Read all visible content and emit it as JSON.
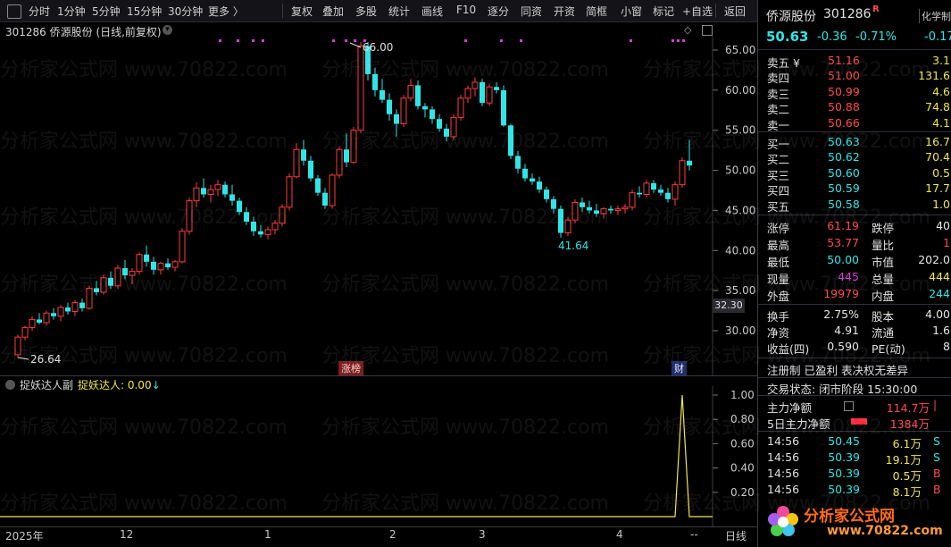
{
  "toolbar": {
    "items": [
      "分时",
      "1分钟",
      "5分钟",
      "15分钟",
      "30分钟",
      "更多 〉",
      "复权",
      "叠加",
      "多股",
      "统计",
      "画线",
      "F10",
      "逐分",
      "同资",
      "开资",
      "简框",
      "小窗",
      "标记",
      "+自选",
      "返回"
    ]
  },
  "chart_header": {
    "title": "301286  侨源股份 (日线,前复权)"
  },
  "main_chart": {
    "y_ticks": [
      "65.00",
      "60.00",
      "55.00",
      "50.00",
      "45.00",
      "40.00",
      "35.00",
      "30.00"
    ],
    "price_tag": "32.30",
    "high_label": "66.00",
    "low_label": "41.64",
    "start_label": "26.64",
    "event_tags": [
      "涨榜",
      "财"
    ]
  },
  "indicator": {
    "name": "捉妖达人副",
    "value_label": "捉妖达人: 0.00",
    "arrow": "↓",
    "y_ticks": [
      "1.00",
      "0.80",
      "0.60",
      "0.40",
      "0.20"
    ]
  },
  "x_axis": {
    "labels": [
      "2025年",
      "12",
      "1",
      "2",
      "3",
      "4",
      "--"
    ],
    "period": "日线"
  },
  "chart_data": {
    "type": "candlestick",
    "ylim": [
      27,
      67
    ],
    "candles": [
      [
        27.0,
        29.5,
        26.6,
        29.2
      ],
      [
        29.2,
        30.6,
        28.8,
        30.4
      ],
      [
        30.4,
        31.8,
        30.0,
        31.4
      ],
      [
        31.4,
        32.2,
        30.8,
        31.0
      ],
      [
        31.0,
        32.5,
        30.6,
        32.2
      ],
      [
        32.2,
        32.8,
        31.4,
        31.8
      ],
      [
        31.8,
        33.2,
        31.2,
        32.9
      ],
      [
        32.9,
        33.5,
        32.0,
        32.4
      ],
      [
        32.4,
        33.8,
        31.8,
        33.5
      ],
      [
        33.5,
        34.0,
        32.4,
        32.8
      ],
      [
        32.8,
        35.6,
        32.6,
        35.3
      ],
      [
        35.3,
        36.2,
        34.4,
        34.8
      ],
      [
        34.8,
        37.0,
        34.5,
        36.6
      ],
      [
        36.6,
        37.4,
        35.2,
        35.6
      ],
      [
        35.6,
        38.2,
        35.2,
        37.8
      ],
      [
        37.8,
        38.8,
        36.4,
        36.9
      ],
      [
        36.9,
        37.8,
        35.8,
        37.4
      ],
      [
        37.4,
        39.8,
        37.0,
        39.5
      ],
      [
        39.5,
        40.6,
        38.0,
        38.6
      ],
      [
        38.6,
        39.2,
        37.0,
        37.6
      ],
      [
        37.6,
        38.6,
        37.0,
        38.4
      ],
      [
        38.4,
        39.0,
        37.6,
        37.9
      ],
      [
        37.9,
        38.8,
        37.4,
        38.6
      ],
      [
        38.6,
        42.8,
        38.4,
        42.4
      ],
      [
        42.4,
        46.6,
        42.0,
        46.2
      ],
      [
        46.2,
        48.5,
        45.4,
        47.8
      ],
      [
        47.8,
        49.0,
        46.6,
        47.0
      ],
      [
        47.0,
        48.2,
        46.0,
        47.6
      ],
      [
        47.6,
        48.8,
        46.8,
        48.2
      ],
      [
        48.2,
        48.6,
        46.6,
        47.0
      ],
      [
        47.0,
        48.2,
        45.6,
        46.2
      ],
      [
        46.2,
        46.6,
        44.4,
        44.8
      ],
      [
        44.8,
        45.4,
        43.2,
        43.6
      ],
      [
        43.6,
        44.2,
        41.8,
        42.4
      ],
      [
        42.4,
        43.2,
        41.6,
        42.0
      ],
      [
        42.0,
        43.0,
        41.4,
        42.6
      ],
      [
        42.6,
        43.8,
        42.0,
        43.4
      ],
      [
        43.4,
        45.8,
        43.0,
        45.4
      ],
      [
        45.4,
        49.6,
        45.0,
        49.2
      ],
      [
        49.2,
        53.4,
        49.0,
        52.6
      ],
      [
        52.6,
        53.8,
        50.6,
        51.2
      ],
      [
        51.2,
        51.8,
        48.6,
        49.0
      ],
      [
        49.0,
        49.4,
        46.8,
        47.2
      ],
      [
        47.2,
        47.8,
        45.2,
        45.6
      ],
      [
        45.6,
        49.6,
        45.2,
        49.4
      ],
      [
        49.4,
        53.0,
        49.0,
        52.6
      ],
      [
        52.6,
        54.6,
        50.4,
        51.0
      ],
      [
        51.0,
        55.4,
        50.8,
        55.0
      ],
      [
        55.0,
        66.0,
        54.6,
        65.5
      ],
      [
        65.5,
        66.0,
        61.2,
        62.0
      ],
      [
        62.0,
        62.8,
        59.2,
        60.0
      ],
      [
        60.0,
        61.4,
        58.4,
        58.8
      ],
      [
        58.8,
        59.6,
        56.2,
        57.0
      ],
      [
        57.0,
        57.6,
        54.2,
        55.8
      ],
      [
        55.8,
        59.4,
        55.4,
        59.0
      ],
      [
        59.0,
        61.4,
        58.6,
        60.6
      ],
      [
        60.6,
        61.2,
        57.6,
        58.0
      ],
      [
        58.0,
        58.4,
        56.6,
        57.6
      ],
      [
        57.6,
        58.0,
        55.8,
        56.4
      ],
      [
        56.4,
        57.0,
        54.8,
        55.2
      ],
      [
        55.2,
        55.8,
        53.6,
        54.2
      ],
      [
        54.2,
        57.0,
        53.8,
        56.6
      ],
      [
        56.6,
        59.4,
        56.2,
        59.0
      ],
      [
        59.0,
        60.6,
        58.4,
        60.2
      ],
      [
        60.2,
        61.6,
        59.2,
        61.0
      ],
      [
        61.0,
        61.4,
        58.0,
        58.4
      ],
      [
        58.4,
        60.8,
        58.0,
        60.4
      ],
      [
        60.4,
        61.0,
        59.6,
        60.0
      ],
      [
        60.0,
        60.6,
        55.4,
        55.6
      ],
      [
        55.6,
        55.8,
        51.4,
        51.8
      ],
      [
        51.8,
        52.4,
        49.6,
        50.2
      ],
      [
        50.2,
        50.8,
        48.6,
        49.0
      ],
      [
        49.0,
        49.6,
        48.2,
        48.6
      ],
      [
        48.6,
        49.2,
        47.2,
        47.6
      ],
      [
        47.6,
        48.0,
        46.0,
        46.4
      ],
      [
        46.4,
        46.8,
        44.6,
        45.2
      ],
      [
        45.2,
        45.6,
        41.6,
        42.2
      ],
      [
        42.2,
        44.2,
        41.8,
        43.8
      ],
      [
        43.8,
        46.4,
        43.4,
        46.0
      ],
      [
        46.0,
        46.6,
        44.8,
        45.4
      ],
      [
        45.4,
        46.2,
        44.6,
        45.0
      ],
      [
        45.0,
        45.8,
        44.2,
        44.6
      ],
      [
        44.6,
        45.4,
        44.0,
        45.2
      ],
      [
        45.2,
        45.6,
        44.6,
        45.0
      ],
      [
        45.0,
        45.6,
        44.4,
        45.2
      ],
      [
        45.2,
        45.8,
        44.6,
        45.4
      ],
      [
        45.4,
        47.6,
        45.0,
        47.2
      ],
      [
        47.2,
        48.0,
        46.6,
        47.0
      ],
      [
        47.0,
        48.8,
        46.6,
        48.4
      ],
      [
        48.4,
        48.8,
        47.2,
        47.6
      ],
      [
        47.6,
        48.2,
        46.8,
        47.2
      ],
      [
        47.2,
        47.8,
        46.0,
        46.4
      ],
      [
        46.4,
        48.6,
        45.6,
        48.2
      ],
      [
        48.2,
        51.6,
        47.8,
        51.2
      ],
      [
        51.2,
        53.8,
        50.0,
        50.6
      ]
    ],
    "indicator_values": {
      "spike_index": 93,
      "spike_value": 1.0
    }
  },
  "quote": {
    "name": "侨源股份",
    "code": "301286",
    "flag": "R",
    "tab": "化学制",
    "price": "50.63",
    "change": "-0.36",
    "change_pct": "-0.71%",
    "right_small": "-0.17",
    "asks": [
      {
        "label": "卖五 ¥",
        "price": "51.16",
        "vol": "3.1"
      },
      {
        "label": "卖四",
        "price": "51.00",
        "vol": "131.6"
      },
      {
        "label": "卖三",
        "price": "50.99",
        "vol": "4.6"
      },
      {
        "label": "卖二",
        "price": "50.88",
        "vol": "74.8"
      },
      {
        "label": "卖一",
        "price": "50.66",
        "vol": "4.1"
      }
    ],
    "bids": [
      {
        "label": "买一",
        "price": "50.63",
        "vol": "16.7"
      },
      {
        "label": "买二",
        "price": "50.62",
        "vol": "70.4"
      },
      {
        "label": "买三",
        "price": "50.60",
        "vol": "0.5"
      },
      {
        "label": "买四",
        "price": "50.59",
        "vol": "17.7"
      },
      {
        "label": "买五",
        "price": "50.58",
        "vol": "1.0"
      }
    ],
    "stats1": [
      {
        "l1": "涨停",
        "v1": "61.19",
        "l2": "跌停",
        "v2": "40"
      },
      {
        "l1": "最高",
        "v1": "53.77",
        "l2": "量比",
        "v2": "1"
      },
      {
        "l1": "最低",
        "v1": "50.00",
        "l2": "市值",
        "v2": "202.0"
      },
      {
        "l1": "现量",
        "v1": "445",
        "l2": "总量",
        "v2": "444"
      },
      {
        "l1": "外盘",
        "v1": "19979",
        "l2": "内盘",
        "v2": "244"
      }
    ],
    "stats2": [
      {
        "l1": "换手",
        "v1": "2.75%",
        "l2": "股本",
        "v2": "4.00"
      },
      {
        "l1": "净资",
        "v1": "4.91",
        "l2": "流通",
        "v2": "1.6"
      },
      {
        "l1": "收益(四)",
        "v1": "0.590",
        "l2": "PE(动)",
        "v2": "8"
      }
    ],
    "info_line": "注册制 已盈利 表决权无差异",
    "status_line": "交易状态: 闭市阶段 15:30:00",
    "flow": [
      {
        "label": "主力净额",
        "value": "114.7万"
      },
      {
        "label": "5日主力净额",
        "value": "1384万"
      }
    ],
    "ticks": [
      {
        "time": "14:56",
        "price": "50.45",
        "vol": "6.1万",
        "side": "S"
      },
      {
        "time": "14:56",
        "price": "50.39",
        "vol": "19.1万",
        "side": "S"
      },
      {
        "time": "14:56",
        "price": "50.39",
        "vol": "0.5万",
        "side": "B"
      },
      {
        "time": "14:56",
        "price": "50.39",
        "vol": "8.1万",
        "side": "B"
      }
    ]
  },
  "watermark": {
    "text": "分析家公式网 www.70822.com",
    "logo_text": "分析家公式网",
    "logo_url": "www.70822.com"
  },
  "colors": {
    "up": "#ff3b3b",
    "down": "#2ee6e6",
    "bg": "#000000"
  }
}
